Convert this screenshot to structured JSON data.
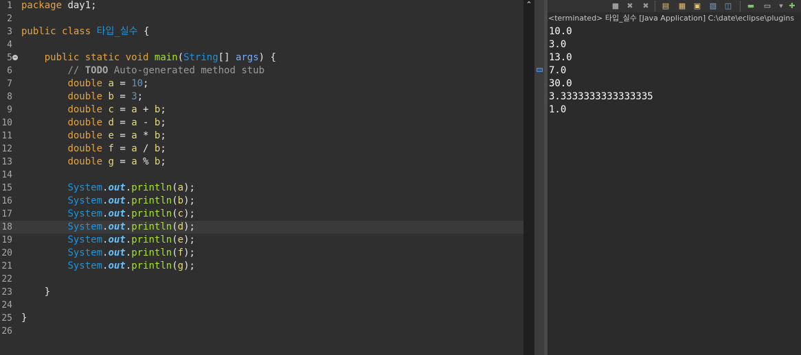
{
  "editor": {
    "current_line": "18",
    "lines": [
      {
        "n": "1",
        "tokens": [
          {
            "c": "kw",
            "t": "package"
          },
          {
            "c": "pl",
            "t": " day1;"
          }
        ]
      },
      {
        "n": "2",
        "tokens": []
      },
      {
        "n": "3",
        "tokens": [
          {
            "c": "kw",
            "t": "public"
          },
          {
            "c": "pl",
            "t": " "
          },
          {
            "c": "kw",
            "t": "class"
          },
          {
            "c": "pl",
            "t": " "
          },
          {
            "c": "cls",
            "t": "타입_실수"
          },
          {
            "c": "pl",
            "t": " {"
          }
        ]
      },
      {
        "n": "4",
        "tokens": []
      },
      {
        "n": "5",
        "tokens": [
          {
            "c": "pl",
            "t": "    "
          },
          {
            "c": "kw",
            "t": "public"
          },
          {
            "c": "pl",
            "t": " "
          },
          {
            "c": "kw",
            "t": "static"
          },
          {
            "c": "pl",
            "t": " "
          },
          {
            "c": "kw",
            "t": "void"
          },
          {
            "c": "pl",
            "t": " "
          },
          {
            "c": "fn",
            "t": "main"
          },
          {
            "c": "pl",
            "t": "("
          },
          {
            "c": "typ",
            "t": "String"
          },
          {
            "c": "pl",
            "t": "[] "
          },
          {
            "c": "arg",
            "t": "args"
          },
          {
            "c": "pl",
            "t": ") {"
          }
        ]
      },
      {
        "n": "6",
        "tokens": [
          {
            "c": "pl",
            "t": "        "
          },
          {
            "c": "cm",
            "t": "// "
          },
          {
            "c": "todo",
            "t": "TODO"
          },
          {
            "c": "cm",
            "t": " Auto-generated method stub"
          }
        ]
      },
      {
        "n": "7",
        "tokens": [
          {
            "c": "pl",
            "t": "        "
          },
          {
            "c": "kw",
            "t": "double"
          },
          {
            "c": "pl",
            "t": " "
          },
          {
            "c": "var",
            "t": "a"
          },
          {
            "c": "pl",
            "t": " = "
          },
          {
            "c": "num",
            "t": "10"
          },
          {
            "c": "pl",
            "t": ";"
          }
        ]
      },
      {
        "n": "8",
        "tokens": [
          {
            "c": "pl",
            "t": "        "
          },
          {
            "c": "kw",
            "t": "double"
          },
          {
            "c": "pl",
            "t": " "
          },
          {
            "c": "var",
            "t": "b"
          },
          {
            "c": "pl",
            "t": " = "
          },
          {
            "c": "num",
            "t": "3"
          },
          {
            "c": "pl",
            "t": ";"
          }
        ]
      },
      {
        "n": "9",
        "tokens": [
          {
            "c": "pl",
            "t": "        "
          },
          {
            "c": "kw",
            "t": "double"
          },
          {
            "c": "pl",
            "t": " "
          },
          {
            "c": "var",
            "t": "c"
          },
          {
            "c": "pl",
            "t": " = "
          },
          {
            "c": "var",
            "t": "a"
          },
          {
            "c": "pl",
            "t": " + "
          },
          {
            "c": "var",
            "t": "b"
          },
          {
            "c": "pl",
            "t": ";"
          }
        ]
      },
      {
        "n": "10",
        "tokens": [
          {
            "c": "pl",
            "t": "        "
          },
          {
            "c": "kw",
            "t": "double"
          },
          {
            "c": "pl",
            "t": " "
          },
          {
            "c": "var",
            "t": "d"
          },
          {
            "c": "pl",
            "t": " = "
          },
          {
            "c": "var",
            "t": "a"
          },
          {
            "c": "pl",
            "t": " - "
          },
          {
            "c": "var",
            "t": "b"
          },
          {
            "c": "pl",
            "t": ";"
          }
        ]
      },
      {
        "n": "11",
        "tokens": [
          {
            "c": "pl",
            "t": "        "
          },
          {
            "c": "kw",
            "t": "double"
          },
          {
            "c": "pl",
            "t": " "
          },
          {
            "c": "var",
            "t": "e"
          },
          {
            "c": "pl",
            "t": " = "
          },
          {
            "c": "var",
            "t": "a"
          },
          {
            "c": "pl",
            "t": " * "
          },
          {
            "c": "var",
            "t": "b"
          },
          {
            "c": "pl",
            "t": ";"
          }
        ]
      },
      {
        "n": "12",
        "tokens": [
          {
            "c": "pl",
            "t": "        "
          },
          {
            "c": "kw",
            "t": "double"
          },
          {
            "c": "pl",
            "t": " "
          },
          {
            "c": "var",
            "t": "f"
          },
          {
            "c": "pl",
            "t": " = "
          },
          {
            "c": "var",
            "t": "a"
          },
          {
            "c": "pl",
            "t": " / "
          },
          {
            "c": "var",
            "t": "b"
          },
          {
            "c": "pl",
            "t": ";"
          }
        ]
      },
      {
        "n": "13",
        "tokens": [
          {
            "c": "pl",
            "t": "        "
          },
          {
            "c": "kw",
            "t": "double"
          },
          {
            "c": "pl",
            "t": " "
          },
          {
            "c": "var",
            "t": "g"
          },
          {
            "c": "pl",
            "t": " = "
          },
          {
            "c": "var",
            "t": "a"
          },
          {
            "c": "pl",
            "t": " % "
          },
          {
            "c": "var",
            "t": "b"
          },
          {
            "c": "pl",
            "t": ";"
          }
        ]
      },
      {
        "n": "14",
        "tokens": []
      },
      {
        "n": "15",
        "tokens": [
          {
            "c": "pl",
            "t": "        "
          },
          {
            "c": "sys",
            "t": "System"
          },
          {
            "c": "pl",
            "t": "."
          },
          {
            "c": "fld",
            "t": "out"
          },
          {
            "c": "pl",
            "t": "."
          },
          {
            "c": "fn",
            "t": "println"
          },
          {
            "c": "pl",
            "t": "("
          },
          {
            "c": "var",
            "t": "a"
          },
          {
            "c": "pl",
            "t": ");"
          }
        ]
      },
      {
        "n": "16",
        "tokens": [
          {
            "c": "pl",
            "t": "        "
          },
          {
            "c": "sys",
            "t": "System"
          },
          {
            "c": "pl",
            "t": "."
          },
          {
            "c": "fld",
            "t": "out"
          },
          {
            "c": "pl",
            "t": "."
          },
          {
            "c": "fn",
            "t": "println"
          },
          {
            "c": "pl",
            "t": "("
          },
          {
            "c": "var",
            "t": "b"
          },
          {
            "c": "pl",
            "t": ");"
          }
        ]
      },
      {
        "n": "17",
        "tokens": [
          {
            "c": "pl",
            "t": "        "
          },
          {
            "c": "sys",
            "t": "System"
          },
          {
            "c": "pl",
            "t": "."
          },
          {
            "c": "fld",
            "t": "out"
          },
          {
            "c": "pl",
            "t": "."
          },
          {
            "c": "fn",
            "t": "println"
          },
          {
            "c": "pl",
            "t": "("
          },
          {
            "c": "var",
            "t": "c"
          },
          {
            "c": "pl",
            "t": ");"
          }
        ]
      },
      {
        "n": "18",
        "tokens": [
          {
            "c": "pl",
            "t": "        "
          },
          {
            "c": "sys",
            "t": "System"
          },
          {
            "c": "pl",
            "t": "."
          },
          {
            "c": "fld",
            "t": "out"
          },
          {
            "c": "pl",
            "t": "."
          },
          {
            "c": "fn",
            "t": "println"
          },
          {
            "c": "pl",
            "t": "("
          },
          {
            "c": "var",
            "t": "d"
          },
          {
            "c": "pl",
            "t": ");"
          }
        ]
      },
      {
        "n": "19",
        "tokens": [
          {
            "c": "pl",
            "t": "        "
          },
          {
            "c": "sys",
            "t": "System"
          },
          {
            "c": "pl",
            "t": "."
          },
          {
            "c": "fld",
            "t": "out"
          },
          {
            "c": "pl",
            "t": "."
          },
          {
            "c": "fn",
            "t": "println"
          },
          {
            "c": "pl",
            "t": "("
          },
          {
            "c": "var",
            "t": "e"
          },
          {
            "c": "pl",
            "t": ");"
          }
        ]
      },
      {
        "n": "20",
        "tokens": [
          {
            "c": "pl",
            "t": "        "
          },
          {
            "c": "sys",
            "t": "System"
          },
          {
            "c": "pl",
            "t": "."
          },
          {
            "c": "fld",
            "t": "out"
          },
          {
            "c": "pl",
            "t": "."
          },
          {
            "c": "fn",
            "t": "println"
          },
          {
            "c": "pl",
            "t": "("
          },
          {
            "c": "var",
            "t": "f"
          },
          {
            "c": "pl",
            "t": ");"
          }
        ]
      },
      {
        "n": "21",
        "tokens": [
          {
            "c": "pl",
            "t": "        "
          },
          {
            "c": "sys",
            "t": "System"
          },
          {
            "c": "pl",
            "t": "."
          },
          {
            "c": "fld",
            "t": "out"
          },
          {
            "c": "pl",
            "t": "."
          },
          {
            "c": "fn",
            "t": "println"
          },
          {
            "c": "pl",
            "t": "("
          },
          {
            "c": "var",
            "t": "g"
          },
          {
            "c": "pl",
            "t": ");"
          }
        ]
      },
      {
        "n": "22",
        "tokens": []
      },
      {
        "n": "23",
        "tokens": [
          {
            "c": "pl",
            "t": "    }"
          }
        ]
      },
      {
        "n": "24",
        "tokens": []
      },
      {
        "n": "25",
        "tokens": [
          {
            "c": "pl",
            "t": "}"
          }
        ]
      },
      {
        "n": "26",
        "tokens": []
      }
    ]
  },
  "console": {
    "status": "<terminated> 타입_실수 [Java Application] C:\\date\\eclipse\\plugins",
    "output": [
      "10.0",
      "3.0",
      "13.0",
      "7.0",
      "30.0",
      "3.3333333333333335",
      "1.0"
    ],
    "toolbar_icons": [
      {
        "name": "terminate-icon",
        "glyph": "■",
        "color": "#9a9a9a"
      },
      {
        "name": "remove-launch-icon",
        "glyph": "✖",
        "color": "#9a9a9a"
      },
      {
        "name": "remove-all-terminated-icon",
        "glyph": "✖",
        "color": "#9a9a9a"
      },
      {
        "name": "scroll-lock-icon",
        "glyph": "▤",
        "color": "#e8c36a"
      },
      {
        "name": "word-wrap-icon",
        "glyph": "▦",
        "color": "#e8c36a"
      },
      {
        "name": "show-on-output-icon",
        "glyph": "▣",
        "color": "#e8c36a"
      },
      {
        "name": "show-on-error-icon",
        "glyph": "▨",
        "color": "#6fa8e0"
      },
      {
        "name": "pin-console-icon",
        "glyph": "◫",
        "color": "#6fa8e0"
      },
      {
        "name": "display-console-icon",
        "glyph": "▬",
        "color": "#7ec16f"
      },
      {
        "name": "open-console-icon",
        "glyph": "▭",
        "color": "#d0d0d0"
      },
      {
        "name": "console-menu-chevron-icon",
        "glyph": "▾",
        "color": "#a0a0a0"
      },
      {
        "name": "new-console-icon",
        "glyph": "✚",
        "color": "#7ec16f"
      }
    ]
  },
  "scroll": {
    "up_glyph": "⌃"
  }
}
